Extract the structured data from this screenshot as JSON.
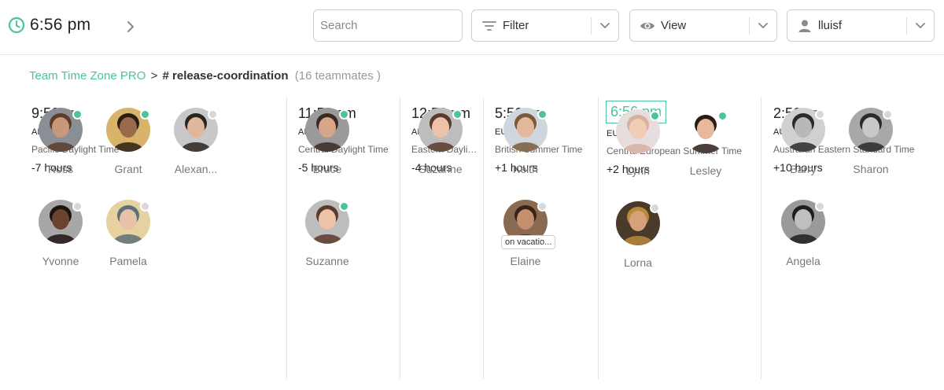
{
  "header": {
    "current_time": "6:56 pm",
    "search_placeholder": "Search",
    "filter_label": "Filter",
    "view_label": "View",
    "user_label": "lluisf"
  },
  "breadcrumb": {
    "app": "Team Time Zone PRO",
    "separator": ">",
    "channel": "# release-coordination",
    "count": "(16 teammates )"
  },
  "colors": {
    "accent": "#4cc39a",
    "online": "#4cc39a",
    "offline": "#d8d8d8"
  },
  "columns": [
    {
      "time": "9:56 am",
      "region": "AMERICA",
      "tz": "Pacific Daylight Time",
      "offset": "-7 hours",
      "current": false,
      "people": [
        {
          "name": "Ross",
          "status": "online",
          "skin": "#c9987a",
          "hair": "#5a3e2b",
          "bg": "#8a8f96"
        },
        {
          "name": "Grant",
          "status": "online",
          "skin": "#9a6a4a",
          "hair": "#2a1d15",
          "bg": "#d8b46a"
        },
        {
          "name": "Alexan...",
          "status": "offline",
          "skin": "#e0b79a",
          "hair": "#2b2320",
          "bg": "#c8c8c8"
        },
        {
          "name": "Yvonne",
          "status": "offline",
          "skin": "#6b4330",
          "hair": "#1e1410",
          "bg": "#a7a7a7"
        },
        {
          "name": "Pamela",
          "status": "offline",
          "skin": "#e7c2a8",
          "hair": "#5f6f78",
          "bg": "#e6d2a0"
        }
      ]
    },
    {
      "time": "11:56 am",
      "region": "AMERICA",
      "tz": "Central Daylight Time",
      "offset": "-5 hours",
      "current": false,
      "people": [
        {
          "name": "Bruce",
          "status": "online",
          "skin": "#d7a588",
          "hair": "#3a2b22",
          "bg": "#9a9a9a"
        },
        {
          "name": "Suzanne",
          "status": "online",
          "skin": "#ecc3a9",
          "hair": "#5a3a2a",
          "bg": "#bdbdbd"
        }
      ]
    },
    {
      "time": "12:56 pm",
      "region": "AMERICA",
      "tz": "Eastern Daylight Time",
      "offset": "-4 hours",
      "current": false,
      "people": [
        {
          "name": "Suzanne",
          "status": "online",
          "skin": "#ecc3a9",
          "hair": "#5a3a2a",
          "bg": "#bdbdbd"
        }
      ]
    },
    {
      "time": "5:56 pm",
      "region": "EUROPE",
      "tz": "British Summer Time",
      "offset": "+1 hours",
      "current": false,
      "people": [
        {
          "name": "Keith",
          "status": "online",
          "skin": "#e3b89c",
          "hair": "#7a5a3a",
          "bg": "#cfd6dc"
        },
        {
          "name": "Elaine",
          "status": "offline",
          "skin": "#c58f6d",
          "hair": "#3a241a",
          "bg": "#8a6a50",
          "badge": "on vacatio..."
        }
      ]
    },
    {
      "time": "6:56 pm",
      "region": "EUROPE",
      "tz": "Central European Summer Time",
      "offset": "+2 hours",
      "current": true,
      "people": [
        {
          "name": "Lynn",
          "status": "online",
          "skin": "#f1cdb6",
          "hair": "#d8b0a0",
          "bg": "#e6dede"
        },
        {
          "name": "Lesley",
          "status": "online",
          "skin": "#e8b89a",
          "hair": "#2a1d18",
          "bg": "#ffffff"
        },
        {
          "name": "Lorna",
          "status": "offline",
          "skin": "#d6a07a",
          "hair": "#b88a3a",
          "bg": "#4a3a2a"
        }
      ]
    },
    {
      "time": "2:56 am",
      "region": "AUSTRALIA",
      "tz": "Australian Eastern Standard Time",
      "offset": "+10 hours",
      "current": false,
      "people": [
        {
          "name": "Barry",
          "status": "offline",
          "skin": "#b8b8b8",
          "hair": "#2a2a2a",
          "bg": "#d0d0d0"
        },
        {
          "name": "Sharon",
          "status": "offline",
          "skin": "#c8c8c8",
          "hair": "#2a2a2a",
          "bg": "#a8a8a8"
        },
        {
          "name": "Angela",
          "status": "offline",
          "skin": "#c0c0c0",
          "hair": "#1e1e1e",
          "bg": "#9a9a9a"
        }
      ]
    }
  ]
}
